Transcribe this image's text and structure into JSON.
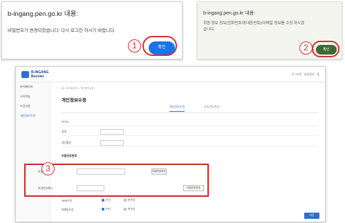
{
  "dialog1": {
    "host": "b-ingang.pen.go.kr 내용:",
    "message": "비밀번호가 변경되었습니다. 다시 로그인 하시기 바랍니다.",
    "ok_label": "확인"
  },
  "dialog2": {
    "host": "b-ingang.pen.go.kr 내용:",
    "message": "회원 정보 정보(전화번호/휴대폰번호)/이메일 정보를 수정 하시겠습니다.",
    "ok_label": "확인"
  },
  "annotations": {
    "step1": "1",
    "step2": "2",
    "step3": "3"
  },
  "app": {
    "brand_line1": "B-INGANG",
    "brand_line2": "Booster",
    "top_links": "로그아웃 · 회원정보 · 홈",
    "sidebar": [
      {
        "label": "마이페이지"
      },
      {
        "label": "나의학습"
      },
      {
        "label": "수강신청"
      },
      {
        "label": "개인정보수정"
      }
    ],
    "breadcrumb": "홈 > 마이페이지 > 개인정보수정",
    "page_title": "개인정보수정",
    "tabs": [
      {
        "label": "개인정보수정"
      },
      {
        "label": "비밀번호변경"
      }
    ],
    "fields": {
      "id_label": "아이디",
      "id_value": "",
      "name_label": "성명",
      "name_value": "",
      "birth_label": "생년월일",
      "birth_note": "",
      "section_label": "비밀번호변경",
      "pw_label": "비밀번호",
      "pw_value": "",
      "pw_button": "비밀번호확인",
      "pw_note": "",
      "pw_confirm_label": "비밀번호확인",
      "pw_confirm_value": "",
      "pw_confirm_button": "비밀번호변경",
      "sms_label": "SMS수신",
      "sms_yes": "수신",
      "sms_no": "미수신",
      "email_label": "이메일수신",
      "email_yes": "수신",
      "email_no": "미수신"
    },
    "save_label": "저장"
  },
  "colors": {
    "accent": "#2e6fc9",
    "annotation": "#d32f2f",
    "dialog1_button": "#1a73e8",
    "dialog2_button": "#3e6b35"
  }
}
